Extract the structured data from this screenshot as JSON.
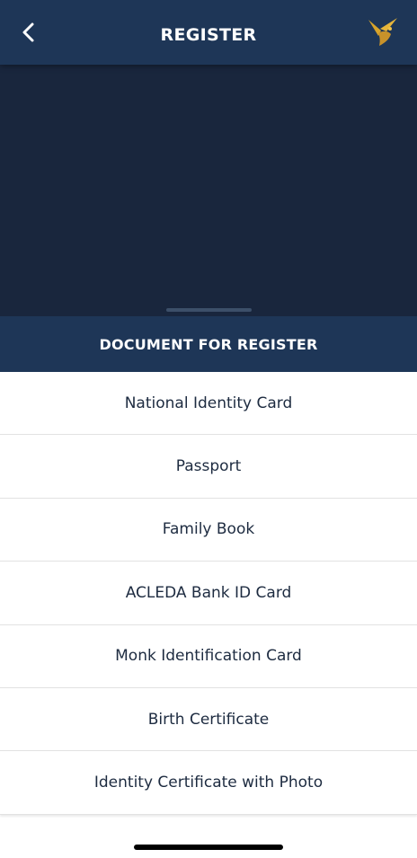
{
  "header": {
    "title": "REGISTER",
    "back_icon": "chevron-left-icon",
    "logo_icon": "bird-logo-icon"
  },
  "sheet": {
    "title": "DOCUMENT FOR REGISTER",
    "documents": [
      {
        "label": "National Identity Card"
      },
      {
        "label": "Passport"
      },
      {
        "label": "Family Book"
      },
      {
        "label": "ACLEDA Bank ID Card"
      },
      {
        "label": "Monk Identification Card"
      },
      {
        "label": "Birth Certificate"
      },
      {
        "label": "Identity Certificate with Photo"
      }
    ]
  },
  "colors": {
    "header_bg": "#1e3657",
    "backdrop": "#19263d",
    "logo_gold": "#d8a42a",
    "text_dark": "#1d2b40"
  }
}
